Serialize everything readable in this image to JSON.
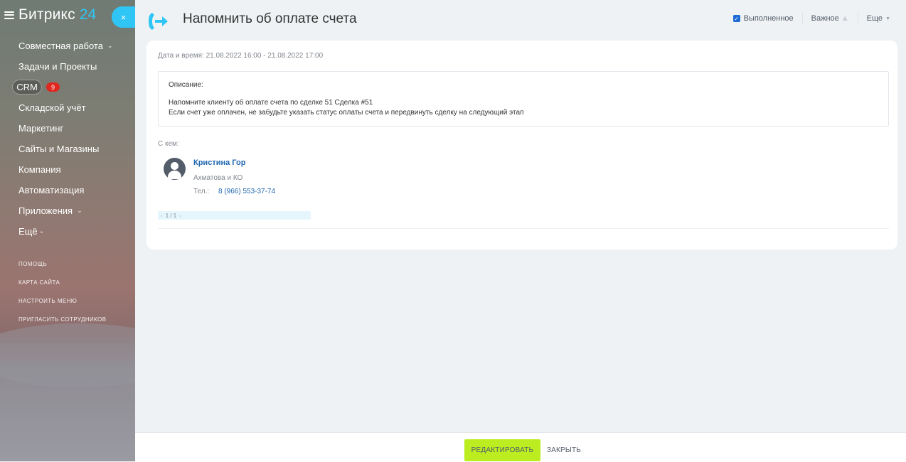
{
  "sidebar": {
    "logo": "Битрикс",
    "logo_number": "24",
    "items": [
      {
        "label": "Совместная работа"
      },
      {
        "label": "Задачи и Проекты"
      },
      {
        "label": "CRM",
        "badge": "9"
      },
      {
        "label": "Складской учёт"
      },
      {
        "label": "Маркетинг"
      },
      {
        "label": "Сайты и Магазины"
      },
      {
        "label": "Компания"
      },
      {
        "label": "Автоматизация"
      },
      {
        "label": "Приложения"
      },
      {
        "label": "Ещё -"
      }
    ],
    "links": [
      "ПОМОЩЬ",
      "КАРТА САЙТА",
      "НАСТРОИТЬ МЕНЮ",
      "ПРИГЛАСИТЬ СОТРУДНИКОВ"
    ],
    "close_glyph": "×"
  },
  "header": {
    "title": "Напомнить об оплате счета",
    "completed_label": "Выполненное",
    "completed_checked": true,
    "important_label": "Важное",
    "more_label": "Еще"
  },
  "activity": {
    "datetime_label": "Дата и время:",
    "datetime_value": "21.08.2022 16:00 - 21.08.2022 17:00",
    "description_title": "Описание:",
    "description_line1": "Напомните клиенту об оплате счета по сделке 51 Сделка #51",
    "description_line2": "Если счет уже оплачен, не забудьте указать статус оплаты счета и передвинуть сделку на следующий этап",
    "with_label": "С кем:",
    "contact": {
      "name": "Кристина Гор",
      "company": "Ахматова и КО",
      "phone_label": "Тел.:",
      "phone": "8 (966) 553-37-74"
    },
    "pager": "1 / 1"
  },
  "footer": {
    "edit_label": "РЕДАКТИРОВАТЬ",
    "close_label": "ЗАКРЫТЬ"
  },
  "colors": {
    "accent": "#2fc6f6",
    "edit_button": "#bbed21",
    "link": "#2067b0",
    "badge": "#e0271f"
  }
}
